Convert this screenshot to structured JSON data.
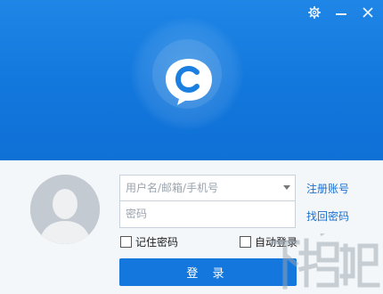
{
  "window": {
    "controls": [
      "settings",
      "minimize",
      "close"
    ]
  },
  "brand": {
    "logo_icon": "chat-bubble-c-logo"
  },
  "login": {
    "username_placeholder": "用户名/邮箱/手机号",
    "password_placeholder": "密码",
    "register_link": "注册账号",
    "recover_link": "找回密码",
    "remember_password": "记住密码",
    "auto_login": "自动登录",
    "submit_label": "登 录"
  },
  "watermark": {
    "text": "下载吧"
  },
  "colors": {
    "accent": "#1377dd",
    "banner_top": "#1f86e6",
    "link": "#1a6fcf"
  }
}
